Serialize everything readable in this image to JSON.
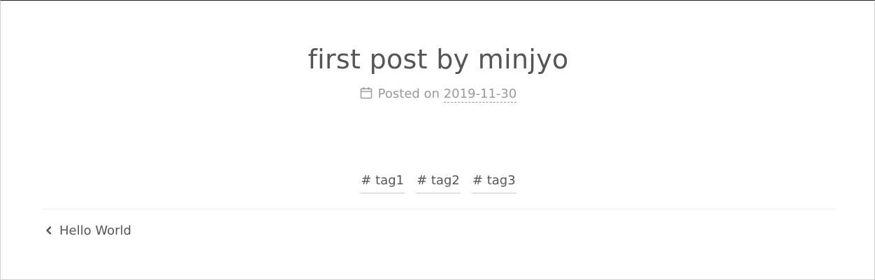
{
  "post": {
    "title": "first post by minjyo",
    "meta_prefix": "Posted on",
    "date": "2019-11-30",
    "tags": [
      "# tag1",
      "# tag2",
      "# tag3"
    ]
  },
  "nav": {
    "prev_label": "Hello World"
  },
  "icons": {
    "meta": "calendar-icon",
    "prev": "chevron-left-icon"
  },
  "colors": {
    "text": "#555555",
    "meta": "#999999",
    "divider": "#eeeeee"
  }
}
